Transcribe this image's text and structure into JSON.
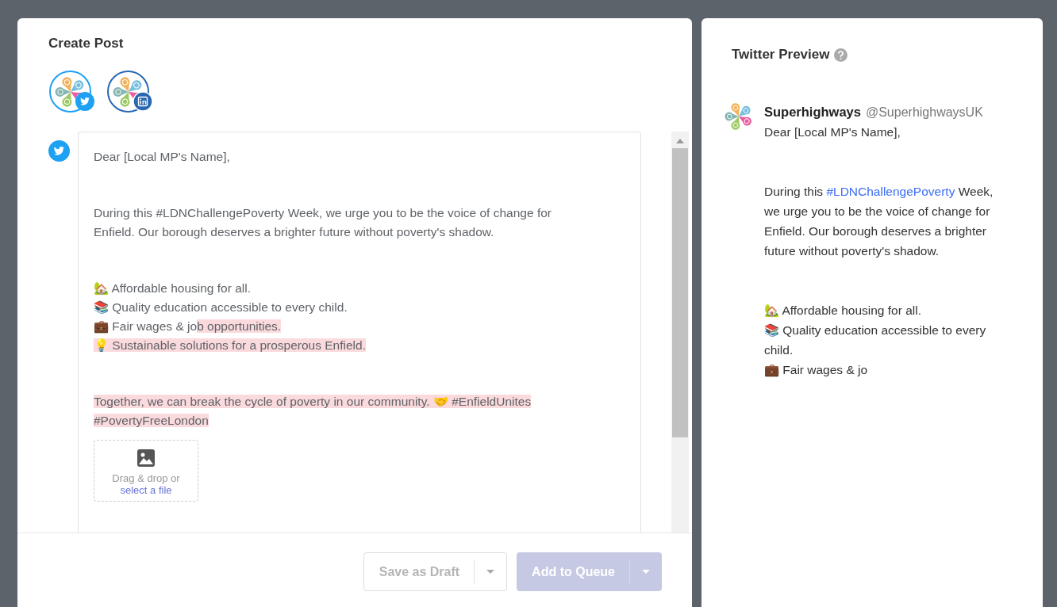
{
  "compose": {
    "title": "Create Post",
    "accounts": [
      {
        "kind": "twitter"
      },
      {
        "kind": "linkedin"
      }
    ],
    "editor": {
      "paragraphs": [
        {
          "lines": [
            [
              {
                "text": "Dear [Local MP's Name],",
                "kind": "plain"
              }
            ]
          ]
        },
        {
          "lines": [
            [
              {
                "text": "During this #LDNChallengePoverty Week, we urge you to be the voice of change for",
                "kind": "plain"
              }
            ],
            [
              {
                "text": "Enfield. Our borough deserves a brighter future without poverty's shadow.",
                "kind": "plain"
              }
            ]
          ]
        },
        {
          "lines": [
            [
              {
                "text": "🏡 Affordable housing for all.",
                "kind": "plain"
              }
            ],
            [
              {
                "text": "📚 Quality education accessible to every child.",
                "kind": "plain"
              }
            ],
            [
              {
                "text": "💼 Fair wages & jo",
                "kind": "plain"
              },
              {
                "text": "b opportunities.",
                "kind": "highlight"
              }
            ],
            [
              {
                "text": "💡 Sustainable solutions for a prosperous Enfield.",
                "kind": "highlight"
              }
            ]
          ]
        },
        {
          "lines": [
            [
              {
                "text": "Together, we can break the cycle of poverty in our community. 🤝 #EnfieldUnites",
                "kind": "highlight"
              }
            ],
            [
              {
                "text": "#PovertyFreeLondon",
                "kind": "highlight"
              }
            ]
          ]
        }
      ]
    },
    "upload": {
      "text": "Drag & drop or",
      "link": "select a file"
    },
    "buttons": [
      {
        "label": "Save as Draft",
        "kind": "outline",
        "disabled": true
      },
      {
        "label": "Add to Queue",
        "kind": "primary",
        "disabled": true
      }
    ]
  },
  "preview": {
    "title": "Twitter Preview",
    "name": "Superhighways",
    "handle": "@SuperhighwaysUK",
    "paragraphs": [
      {
        "lines": [
          [
            {
              "text": "Dear [Local MP's Name],",
              "kind": "plain"
            }
          ]
        ]
      },
      {
        "lines": [
          [
            {
              "text": "During this ",
              "kind": "plain"
            },
            {
              "text": "#LDNChallengePoverty",
              "kind": "hashtag"
            },
            {
              "text": " Week,",
              "kind": "plain"
            }
          ],
          [
            {
              "text": "we urge you to be the voice of change for",
              "kind": "plain"
            }
          ],
          [
            {
              "text": "Enfield. Our borough deserves a brighter",
              "kind": "plain"
            }
          ],
          [
            {
              "text": "future without poverty's shadow.",
              "kind": "plain"
            }
          ]
        ]
      },
      {
        "lines": [
          [
            {
              "text": "🏡 Affordable housing for all.",
              "kind": "plain"
            }
          ],
          [
            {
              "text": "📚 Quality education accessible to every",
              "kind": "plain"
            }
          ],
          [
            {
              "text": "child.",
              "kind": "plain"
            }
          ],
          [
            {
              "text": "💼 Fair wages & jo",
              "kind": "plain"
            }
          ]
        ]
      }
    ]
  }
}
